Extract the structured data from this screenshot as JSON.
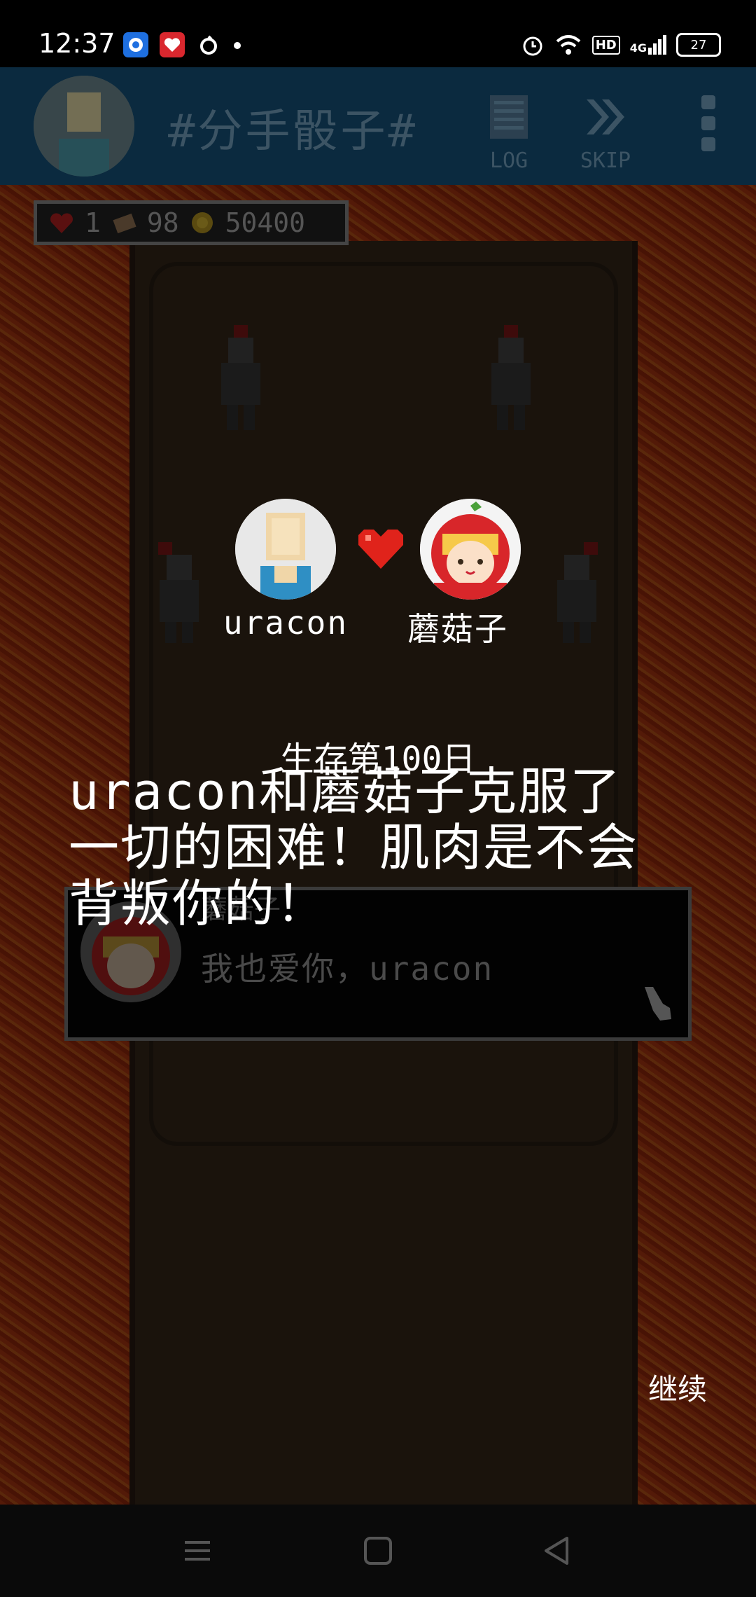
{
  "status_bar": {
    "time": "12:37",
    "battery": "27",
    "network": "4G",
    "hd": "HD"
  },
  "header": {
    "title": "#分手骰子#",
    "log_label": "LOG",
    "skip_label": "SKIP"
  },
  "stats": {
    "hearts": "1",
    "cards": "98",
    "coins": "50400"
  },
  "couple": {
    "left_name": "uracon",
    "right_name": "蘑菇子"
  },
  "day_label": "生存第100日",
  "story_lines": [
    "uracon和蘑菇子克服了",
    "一切的困难！肌肉是不会",
    "背叛你的！"
  ],
  "dialog": {
    "speaker": "蘑菇子",
    "text": "我也爱你，uracon"
  },
  "continue_label": "继续",
  "colors": {
    "header_bg": "#0b2a3f",
    "lava": "#b83a12",
    "heart": "#e0231b"
  }
}
